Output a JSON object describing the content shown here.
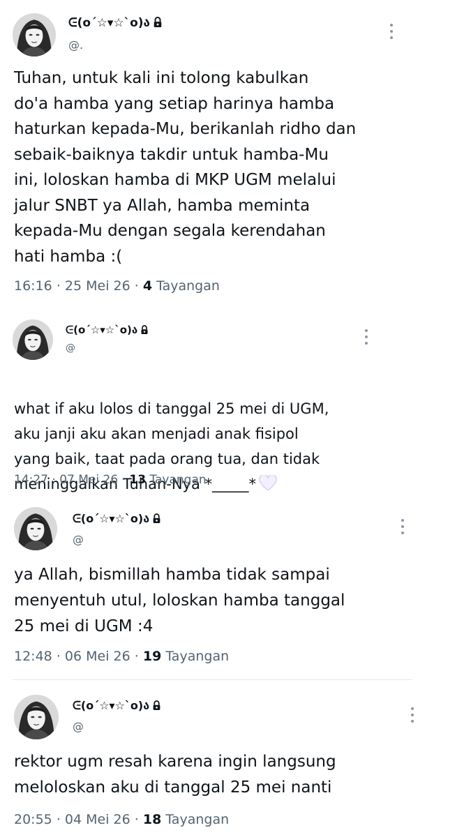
{
  "tweets": [
    {
      "display_name": "ᕮ(o´☆▾☆`o)ა",
      "handle": "@.",
      "text": "Tuhan, untuk kali ini tolong kabulkan\ndo'a hamba yang setiap harinya hamba\nhaturkan kepada-Mu, berikanlah ridho dan\nsebaik-baiknya takdir untuk hamba-Mu\nini, loloskan hamba di MKP UGM melalui\njalur SNBT ya Allah, hamba meminta\nkepada-Mu dengan segala kerendahan\nhati hamba :(",
      "time": "16:16",
      "date": "25 Mei 26",
      "views_count": "4",
      "views_label": "Tayangan"
    },
    {
      "display_name": "ᕮ(o´☆▾☆`o)ა",
      "handle": "@",
      "text": "what if aku lolos di tanggal 25 mei di UGM,\naku janji aku akan menjadi anak fisipol\nyang baik, taat pada orang tua, dan tidak\nmeninggalkan Tuhan-Nya *_____*",
      "time": "14:27",
      "date": "07 Mei 26",
      "views_count": "13",
      "views_label": "Tayangan"
    },
    {
      "display_name": "ᕮ(o´☆▾☆`o)ა",
      "handle": "@",
      "text": "ya Allah, bismillah hamba tidak sampai\nmenyentuh utul, loloskan hamba tanggal\n25 mei di UGM :4",
      "time": "12:48",
      "date": "06 Mei 26",
      "views_count": "19",
      "views_label": "Tayangan"
    },
    {
      "display_name": "ᕮ(o´☆▾☆`o)ა",
      "handle": "@",
      "text": "rektor ugm resah karena ingin langsung\nmeloloskan aku di tanggal 25 mei nanti",
      "time": "20:55",
      "date": "04 Mei 26",
      "views_count": "18",
      "views_label": "Tayangan"
    }
  ],
  "separator": "·",
  "icons": {
    "lock": "lock-icon",
    "more": "more-options-icon",
    "heart": "white-heart-emoji"
  },
  "colors": {
    "text": "#0f1419",
    "secondary": "#536471",
    "divider": "#e7e7e7"
  }
}
